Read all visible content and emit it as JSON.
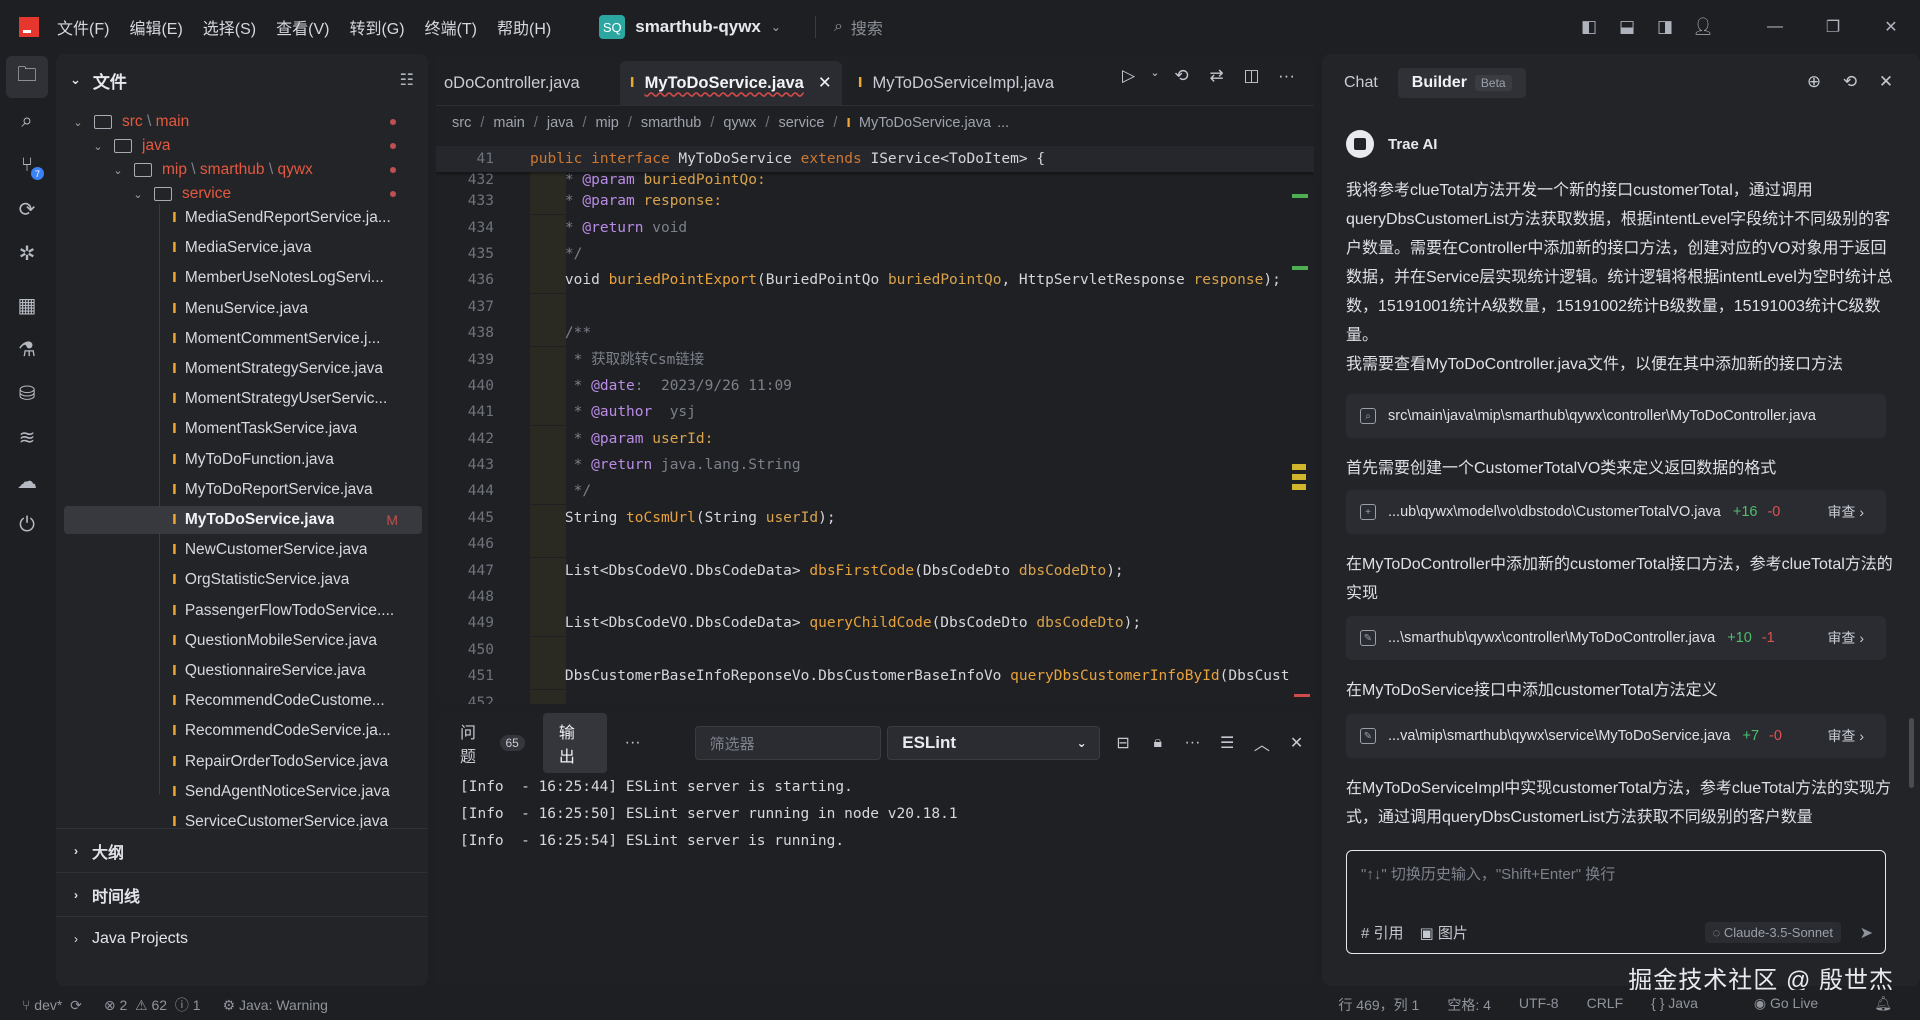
{
  "menu": [
    "文件(F)",
    "编辑(E)",
    "选择(S)",
    "查看(V)",
    "转到(G)",
    "终端(T)",
    "帮助(H)"
  ],
  "project": {
    "badge": "SQ",
    "name": "smarthub-qywx"
  },
  "search": {
    "placeholder": "搜索"
  },
  "explorer": {
    "title": "文件",
    "folders": {
      "src": "src",
      "main": "main",
      "java": "java",
      "mip": "mip",
      "smarthub": "smarthub",
      "qywx": "qywx",
      "service": "service"
    },
    "files": [
      "MediaSendReportService.ja...",
      "MediaService.java",
      "MemberUseNotesLogServi...",
      "MenuService.java",
      "MomentCommentService.j...",
      "MomentStrategyService.java",
      "MomentStrategyUserServic...",
      "MomentTaskService.java",
      "MyToDoFunction.java",
      "MyToDoReportService.java",
      "MyToDoService.java",
      "NewCustomerService.java",
      "OrgStatisticService.java",
      "PassengerFlowTodoService....",
      "QuestionMobileService.java",
      "QuestionnaireService.java",
      "RecommendCodeCustome...",
      "RecommendCodeService.ja...",
      "RepairOrderTodoService.java",
      "SendAgentNoticeService.java",
      "ServiceCustomerService.java"
    ],
    "selected_flag": "M",
    "sections": [
      "大纲",
      "时间线",
      "Java Projects"
    ]
  },
  "editor": {
    "tabs": [
      {
        "label": "oDoController.java"
      },
      {
        "label": "MyToDoService.java"
      },
      {
        "label": "MyToDoServiceImpl.java"
      }
    ],
    "breadcrumb": [
      "src",
      "main",
      "java",
      "mip",
      "smarthub",
      "qywx",
      "service",
      "MyToDoService.java",
      "..."
    ],
    "sticky_line": "41",
    "line_numbers": [
      "432",
      "433",
      "434",
      "435",
      "436",
      "437",
      "438",
      "439",
      "440",
      "441",
      "442",
      "443",
      "444",
      "445",
      "446",
      "447",
      "448",
      "449",
      "450",
      "451",
      "452"
    ]
  },
  "panel": {
    "tabs": [
      {
        "label": "问题",
        "count": "65"
      },
      {
        "label": "输出"
      }
    ],
    "more": "···",
    "filter_placeholder": "筛选器",
    "channel": "ESLint",
    "log": [
      "[Info  - 16:25:44] ESLint server is starting.",
      "[Info  - 16:25:50] ESLint server running in node v20.18.1",
      "[Info  - 16:25:54] ESLint server is running."
    ]
  },
  "chat": {
    "tabs": [
      "Chat",
      "Builder"
    ],
    "beta": "Beta",
    "assistant": "Trae AI",
    "messages": [
      "我将参考clueTotal方法开发一个新的接口customerTotal，通过调用queryDbsCustomerList方法获取数据，根据intentLevel字段统计不同级别的客户数量。需要在Controller中添加新的接口方法，创建对应的VO对象用于返回数据，并在Service层实现统计逻辑。统计逻辑将根据intentLevel为空时统计总数，15191001统计A级数量，15191002统计B级数量，15191003统计C级数量。",
      "我需要查看MyToDoController.java文件，以便在其中添加新的接口方法",
      "首先需要创建一个CustomerTotalVO类来定义返回数据的格式",
      "在MyToDoController中添加新的customerTotal接口方法，参考clueTotal方法的实现",
      "在MyToDoService接口中添加customerTotal方法定义",
      "在MyToDoServiceImpl中实现customerTotal方法，参考clueTotal方法的实现方式，通过调用queryDbsCustomerList方法获取不同级别的客户数量"
    ],
    "search_card": "src\\main\\java\\mip\\smarthub\\qywx\\controller\\MyToDoController.java",
    "file_cards": [
      {
        "path": "...ub\\qywx\\model\\vo\\dbstodo\\CustomerTotalVO.java",
        "add": "+16",
        "del": "-0",
        "review": "审查"
      },
      {
        "path": "...\\smarthub\\qywx\\controller\\MyToDoController.java",
        "add": "+10",
        "del": "-1",
        "review": "审查"
      },
      {
        "path": "...va\\mip\\smarthub\\qywx\\service\\MyToDoService.java",
        "add": "+7",
        "del": "-0",
        "review": "审查"
      }
    ],
    "input_placeholder": "\"↑↓\" 切换历史输入，\"Shift+Enter\" 换行",
    "ref_label": "# 引用",
    "image_label": "图片",
    "model": "Claude-3.5-Sonnet"
  },
  "status": {
    "branch": "dev*",
    "errors": "2",
    "warnings": "62",
    "infos": "1",
    "java": "Java: Warning",
    "position": "行 469，列 1",
    "spaces": "空格: 4",
    "encoding": "UTF-8",
    "eol": "CRLF",
    "language": "Java",
    "golive": "Go Live"
  },
  "watermark": "掘金技术社区 @ 殷世杰"
}
